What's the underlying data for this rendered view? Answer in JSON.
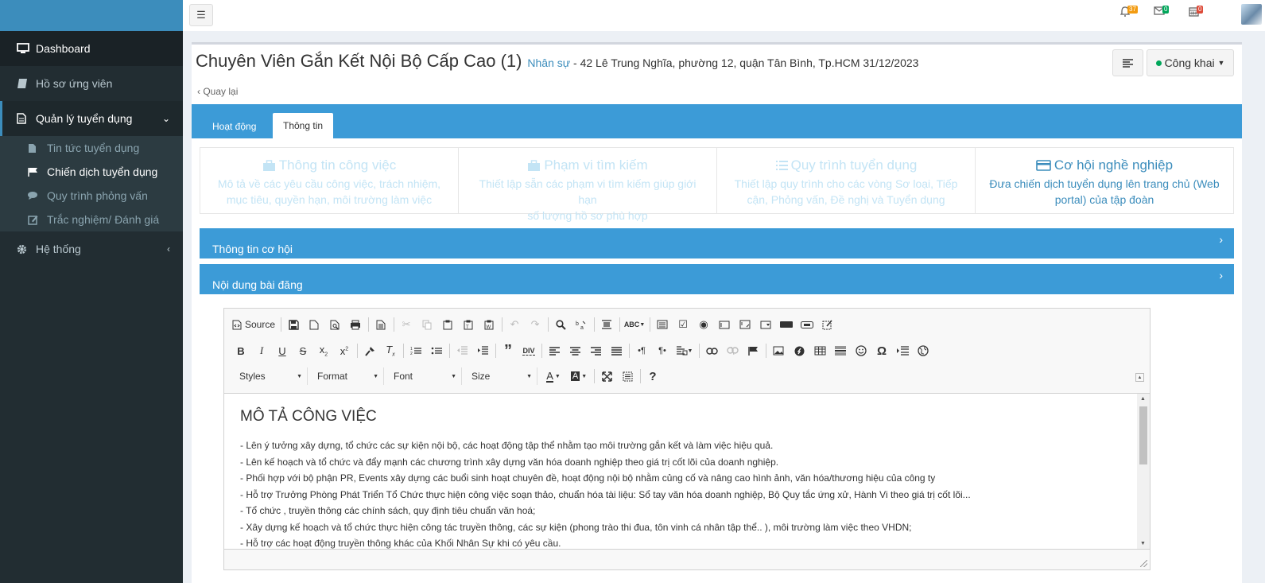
{
  "sidebar": {
    "dashboard": "Dashboard",
    "candidates": "Hồ sơ ứng viên",
    "recruitment": "Quản lý tuyển dụng",
    "sub": [
      "Tin tức tuyển dụng",
      "Chiến dịch tuyển dụng",
      "Quy trình phỏng vấn",
      "Trắc nghiệm/ Đánh giá"
    ],
    "system": "Hệ thống"
  },
  "topbar": {
    "notifications_count": "37",
    "messages_count": "0",
    "calendar_count": "0"
  },
  "header": {
    "title": "Chuyên Viên Gắn Kết Nội Bộ Cấp Cao (1)",
    "department": "Nhân sự",
    "address": " - 42 Lê Trung Nghĩa, phường 12, quận Tân Bình, Tp.HCM 31/12/2023",
    "back": "Quay lại",
    "status": "Công khai"
  },
  "tabs": [
    "Hoạt động",
    "Thông tin"
  ],
  "steps": [
    {
      "title": "Thông tin công việc",
      "desc1": "Mô tả về các yêu cầu công việc, trách nhiệm,",
      "desc2": "mục tiêu, quyền hạn, môi trường làm việc"
    },
    {
      "title": "Phạm vi tìm kiếm",
      "desc1": "Thiết lập sẵn các phạm vi tìm kiếm giúp giới hạn",
      "desc2": "số lượng hồ sơ phù hợp"
    },
    {
      "title": "Quy trình tuyển dụng",
      "desc1": "Thiết lập quy trình cho các vòng Sơ loại, Tiếp",
      "desc2": "cận, Phỏng vấn, Đề nghị và Tuyển dụng"
    },
    {
      "title": "Cơ hội nghề nghiệp",
      "desc1": "Đưa chiến dịch tuyển dụng lên trang chủ (Web",
      "desc2": "portal) của tập đoàn"
    }
  ],
  "sections": {
    "opportunity": "Thông tin cơ hội",
    "post_content": "Nội dung bài đăng"
  },
  "editor": {
    "source": "Source",
    "styles": "Styles",
    "format": "Format",
    "font": "Font",
    "size": "Size",
    "heading": "MÔ TẢ CÔNG VIỆC",
    "lines": [
      "- Lên ý tưởng xây dựng, tổ chức các sự kiện nội bộ, các hoạt động tập thể nhằm tạo môi trường gắn kết và làm việc hiệu quả.",
      "- Lên kế hoạch và tổ chức và đẩy mạnh các chương trình xây dựng văn hóa doanh nghiệp theo giá trị cốt lõi của doanh nghiệp.",
      "- Phối hợp với bộ phận PR, Events xây dựng các buổi sinh hoạt chuyên đề, hoạt động nội bộ nhằm củng cố và nâng cao hình ảnh, văn hóa/thương hiệu của công ty",
      "- Hỗ trợ Trưởng Phòng Phát Triển Tổ Chức thực hiện công việc soạn thảo, chuẩn hóa tài liệu: Sổ tay văn hóa doanh nghiệp, Bộ Quy tắc ứng xử, Hành Vi theo giá trị cốt lõi...",
      "- Tổ chức , truyền thông các chính sách, quy định tiêu chuẩn văn hoá;",
      "- Xây dựng kế hoạch và tổ chức thực hiện công tác truyền thông, các sự kiện (phong trào thi đua, tôn vinh cá nhân tập thể.. ), môi trường làm việc theo VHDN;",
      "- Hỗ trợ các hoạt động truyền thông khác của Khối Nhân Sự khi có yêu cầu."
    ]
  }
}
